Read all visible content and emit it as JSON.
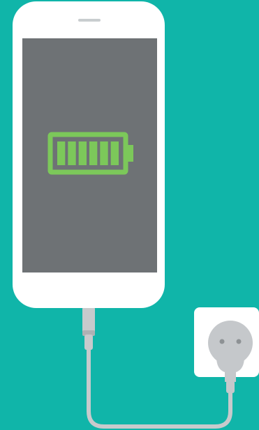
{
  "colors": {
    "background": "#10B5A9",
    "phone_body": "#FFFFFF",
    "screen": "#6E7275",
    "speaker": "#C9CDCF",
    "battery_green": "#7CC85A",
    "cable": "#C7CACC",
    "cable_dark": "#AEB1B4",
    "socket_plate": "#FFFFFF",
    "plug": "#C5C8CB",
    "plug_dark": "#8E9295"
  },
  "battery": {
    "icon": "battery-full-icon",
    "charge_level": 1.0,
    "segments": 6
  },
  "icons": {
    "plug": "power-plug-icon",
    "socket": "wall-socket-icon"
  }
}
